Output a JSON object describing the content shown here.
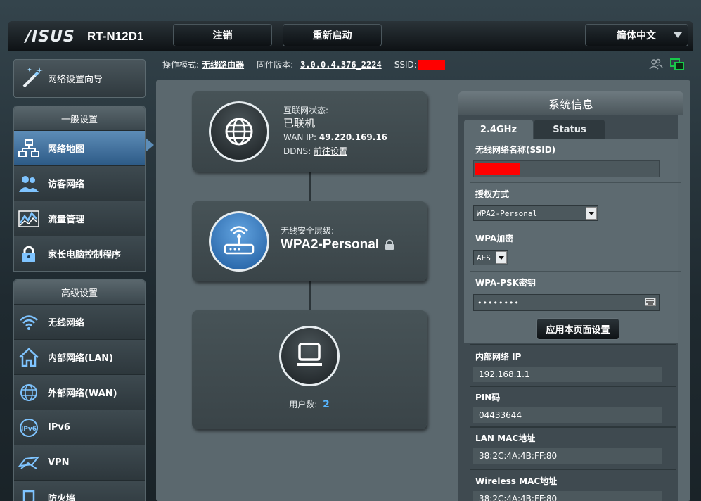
{
  "header": {
    "logo": "/ISUS",
    "model": "RT-N12D1",
    "logout_label": "注销",
    "reboot_label": "重新启动",
    "language": "简体中文"
  },
  "info_bar": {
    "mode_label": "操作模式:",
    "mode_value": "无线路由器",
    "firmware_label": "固件版本:",
    "firmware_value": "3.0.0.4.376_2224",
    "ssid_label": "SSID:"
  },
  "sidebar": {
    "wizard_label": "网络设置向导",
    "general_title": "一般设置",
    "general_items": [
      {
        "label": "网络地图",
        "icon": "network-map-icon"
      },
      {
        "label": "访客网络",
        "icon": "guest-network-icon"
      },
      {
        "label": "流量管理",
        "icon": "traffic-manager-icon"
      },
      {
        "label": "家长电脑控制程序",
        "icon": "parental-control-icon"
      }
    ],
    "advanced_title": "高级设置",
    "advanced_items": [
      {
        "label": "无线网络",
        "icon": "wifi-icon"
      },
      {
        "label": "内部网络(LAN)",
        "icon": "home-icon"
      },
      {
        "label": "外部网络(WAN)",
        "icon": "globe-icon"
      },
      {
        "label": "IPv6",
        "icon": "ipv6-icon"
      },
      {
        "label": "VPN",
        "icon": "vpn-icon"
      },
      {
        "label": "防火墙",
        "icon": "firewall-icon"
      }
    ]
  },
  "map": {
    "internet_status_label": "互联网状态:",
    "internet_status_value": "已联机",
    "wan_ip_label": "WAN IP:",
    "wan_ip_value": "49.220.169.16",
    "ddns_label": "DDNS:",
    "ddns_value": "前往设置",
    "security_label": "无线安全层级:",
    "security_value": "WPA2-Personal",
    "clients_label": "用户数:",
    "clients_value": "2"
  },
  "system": {
    "title": "系统信息",
    "tab_24": "2.4GHz",
    "tab_status": "Status",
    "ssid_label": "无线网络名称(SSID)",
    "auth_label": "授权方式",
    "auth_value": "WPA2-Personal",
    "wpa_enc_label": "WPA加密",
    "wpa_enc_value": "AES",
    "psk_label": "WPA-PSK密钥",
    "psk_value": "••••••••",
    "apply_label": "应用本页面设置",
    "lan_ip_label": "内部网络 IP",
    "lan_ip_value": "192.168.1.1",
    "pin_label": "PIN码",
    "pin_value": "04433644",
    "lan_mac_label": "LAN MAC地址",
    "lan_mac_value": "38:2C:4A:4B:FF:80",
    "wl_mac_label": "Wireless MAC地址",
    "wl_mac_value": "38:2C:4A:4B:FF:80"
  }
}
